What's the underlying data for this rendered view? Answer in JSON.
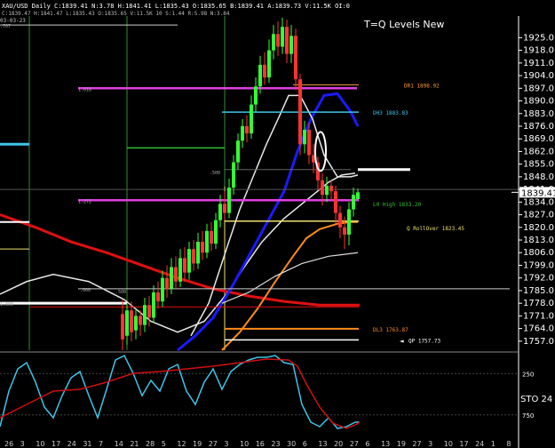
{
  "window": {
    "header": "XAU/USD  Daily  C:1839.41  N:3.78  H:1841.41  L:1835.43  O:1835.65  B:1839.41  A:1839.73  V:11.5K  OI:0",
    "sub_header": "C:1839.47 H:1841.47 L:1835.43 O:1835.65 V:11.5K 10 S:1.44 R:5.98 N:3.84",
    "title": "T=Q Levels New",
    "left_label": "03-03-23"
  },
  "colors": {
    "background": "#000000",
    "price_up": "#33ff33",
    "price_down": "#ff3333",
    "ma_blue": "#1a1aff",
    "ma_orange": "#ff8c1a",
    "ma_white": "#e8e8e8",
    "ma_red": "#e01010",
    "magenta": "#e040e0",
    "cyan": "#3fc6e8",
    "yellow": "#f0e070",
    "green_line": "#30c030",
    "grid_vertical": "#2f8f2f",
    "axis_text": "#ffffff"
  },
  "chart_data": [
    {
      "type": "candlestick",
      "title": "T=Q Levels New",
      "symbol": "XAU/USD",
      "timeframe": "Daily",
      "ylim": [
        1752,
        1937
      ],
      "y_ticks": [
        1925.0,
        1918.0,
        1911.0,
        1904.0,
        1897.0,
        1890.0,
        1883.0,
        1876.0,
        1869.0,
        1862.0,
        1855.0,
        1848.0,
        1841.0,
        1834.0,
        1827.0,
        1820.0,
        1813.0,
        1806.0,
        1799.0,
        1792.0,
        1785.0,
        1778.0,
        1771.0,
        1764.0,
        1757.0
      ],
      "current_price_label": "1839.41",
      "current_price": 1839.41,
      "x_tick_labels": [
        "26",
        "3",
        "10",
        "17",
        "24",
        "31",
        "7",
        "14",
        "21",
        "28",
        "5",
        "12",
        "19",
        "27",
        "3",
        "10",
        "16",
        "23",
        "30",
        "6",
        "13",
        "20",
        "27",
        "6",
        "13",
        "19",
        "27",
        "3",
        "10",
        "17",
        "24",
        "1",
        "8"
      ],
      "levels": [
        {
          "label": "DR1 1898.92",
          "value": 1898.92,
          "color": "magenta-label"
        },
        {
          "label": "DH3 1883.83",
          "value": 1883.83,
          "color": "cyan"
        },
        {
          "label": "L0 High 1833.20",
          "value": 1833.2,
          "color": "green"
        },
        {
          "label": "Q RollOver 1823.45",
          "value": 1823.45,
          "color": "yellow"
        },
        {
          "label": "DL3 1763.87",
          "value": 1763.87,
          "color": "orange"
        },
        {
          "label": "QP 1757.73",
          "value": 1757.73,
          "color": "white"
        }
      ],
      "fib_labels": [
        {
          "label": "1.618",
          "value": 1897.0
        },
        {
          "label": ".500",
          "value": 1851.0
        },
        {
          "label": "1.272",
          "value": 1835.0
        },
        {
          "label": ".000",
          "value": 1786.0
        },
        {
          "label": ".500",
          "value": 1785.0
        },
        {
          "label": "1.000",
          "value": 1778.0
        },
        {
          "label": ".707",
          "value": 1932.0
        }
      ],
      "candles": [
        {
          "x": 138,
          "open": 1772,
          "close": 1758,
          "high": 1780,
          "low": 1752
        },
        {
          "x": 143,
          "open": 1760,
          "close": 1774,
          "high": 1778,
          "low": 1755
        },
        {
          "x": 148,
          "open": 1774,
          "close": 1762,
          "high": 1779,
          "low": 1757
        },
        {
          "x": 153,
          "open": 1763,
          "close": 1771,
          "high": 1775,
          "low": 1758
        },
        {
          "x": 158,
          "open": 1771,
          "close": 1766,
          "high": 1774,
          "low": 1760
        },
        {
          "x": 163,
          "open": 1766,
          "close": 1777,
          "high": 1781,
          "low": 1762
        },
        {
          "x": 168,
          "open": 1777,
          "close": 1770,
          "high": 1782,
          "low": 1765
        },
        {
          "x": 173,
          "open": 1770,
          "close": 1784,
          "high": 1788,
          "low": 1767
        },
        {
          "x": 178,
          "open": 1784,
          "close": 1779,
          "high": 1790,
          "low": 1775
        },
        {
          "x": 183,
          "open": 1779,
          "close": 1792,
          "high": 1796,
          "low": 1776
        },
        {
          "x": 188,
          "open": 1792,
          "close": 1786,
          "high": 1799,
          "low": 1781
        },
        {
          "x": 193,
          "open": 1786,
          "close": 1798,
          "high": 1803,
          "low": 1783
        },
        {
          "x": 198,
          "open": 1798,
          "close": 1790,
          "high": 1804,
          "low": 1786
        },
        {
          "x": 203,
          "open": 1790,
          "close": 1803,
          "high": 1808,
          "low": 1787
        },
        {
          "x": 208,
          "open": 1803,
          "close": 1795,
          "high": 1809,
          "low": 1790
        },
        {
          "x": 213,
          "open": 1795,
          "close": 1808,
          "high": 1812,
          "low": 1791
        },
        {
          "x": 218,
          "open": 1808,
          "close": 1800,
          "high": 1813,
          "low": 1796
        },
        {
          "x": 223,
          "open": 1800,
          "close": 1812,
          "high": 1817,
          "low": 1797
        },
        {
          "x": 228,
          "open": 1812,
          "close": 1806,
          "high": 1818,
          "low": 1802
        },
        {
          "x": 233,
          "open": 1806,
          "close": 1818,
          "high": 1822,
          "low": 1803
        },
        {
          "x": 238,
          "open": 1818,
          "close": 1811,
          "high": 1823,
          "low": 1807
        },
        {
          "x": 243,
          "open": 1811,
          "close": 1824,
          "high": 1828,
          "low": 1808
        },
        {
          "x": 248,
          "open": 1824,
          "close": 1833,
          "high": 1838,
          "low": 1820
        },
        {
          "x": 253,
          "open": 1833,
          "close": 1828,
          "high": 1840,
          "low": 1824
        },
        {
          "x": 258,
          "open": 1828,
          "close": 1842,
          "high": 1847,
          "low": 1825
        },
        {
          "x": 263,
          "open": 1842,
          "close": 1856,
          "high": 1860,
          "low": 1838
        },
        {
          "x": 268,
          "open": 1856,
          "close": 1868,
          "high": 1872,
          "low": 1852
        },
        {
          "x": 273,
          "open": 1868,
          "close": 1876,
          "high": 1880,
          "low": 1864
        },
        {
          "x": 278,
          "open": 1876,
          "close": 1872,
          "high": 1882,
          "low": 1867
        },
        {
          "x": 283,
          "open": 1872,
          "close": 1888,
          "high": 1893,
          "low": 1869
        },
        {
          "x": 288,
          "open": 1888,
          "close": 1898,
          "high": 1903,
          "low": 1884
        },
        {
          "x": 293,
          "open": 1898,
          "close": 1910,
          "high": 1915,
          "low": 1894
        },
        {
          "x": 298,
          "open": 1910,
          "close": 1903,
          "high": 1917,
          "low": 1899
        },
        {
          "x": 303,
          "open": 1903,
          "close": 1918,
          "high": 1924,
          "low": 1900
        },
        {
          "x": 308,
          "open": 1918,
          "close": 1927,
          "high": 1932,
          "low": 1913
        },
        {
          "x": 313,
          "open": 1927,
          "close": 1920,
          "high": 1934,
          "low": 1915
        },
        {
          "x": 318,
          "open": 1920,
          "close": 1931,
          "high": 1936,
          "low": 1916
        },
        {
          "x": 323,
          "open": 1931,
          "close": 1916,
          "high": 1935,
          "low": 1911
        },
        {
          "x": 328,
          "open": 1916,
          "close": 1926,
          "high": 1932,
          "low": 1911
        },
        {
          "x": 333,
          "open": 1926,
          "close": 1902,
          "high": 1930,
          "low": 1896
        },
        {
          "x": 338,
          "open": 1902,
          "close": 1866,
          "high": 1905,
          "low": 1860
        },
        {
          "x": 343,
          "open": 1866,
          "close": 1874,
          "high": 1879,
          "low": 1861
        },
        {
          "x": 348,
          "open": 1874,
          "close": 1860,
          "high": 1878,
          "low": 1855
        },
        {
          "x": 353,
          "open": 1860,
          "close": 1856,
          "high": 1866,
          "low": 1850
        },
        {
          "x": 358,
          "open": 1856,
          "close": 1846,
          "high": 1859,
          "low": 1841
        },
        {
          "x": 363,
          "open": 1846,
          "close": 1838,
          "high": 1850,
          "low": 1832
        },
        {
          "x": 368,
          "open": 1838,
          "close": 1843,
          "high": 1848,
          "low": 1834
        },
        {
          "x": 373,
          "open": 1843,
          "close": 1840,
          "high": 1846,
          "low": 1835
        },
        {
          "x": 378,
          "open": 1840,
          "close": 1828,
          "high": 1843,
          "low": 1822
        },
        {
          "x": 383,
          "open": 1828,
          "close": 1820,
          "high": 1832,
          "low": 1814
        },
        {
          "x": 388,
          "open": 1820,
          "close": 1816,
          "high": 1826,
          "low": 1808
        },
        {
          "x": 393,
          "open": 1816,
          "close": 1830,
          "high": 1834,
          "low": 1810
        },
        {
          "x": 398,
          "open": 1830,
          "close": 1838,
          "high": 1842,
          "low": 1826
        },
        {
          "x": 403,
          "open": 1835.65,
          "close": 1839.41,
          "high": 1841.41,
          "low": 1835.43
        }
      ]
    },
    {
      "type": "line",
      "title": "STO",
      "series_label": "STO",
      "value": "24",
      "ylim": [
        0,
        1000
      ],
      "y_ticks_labels": [
        "250",
        "750"
      ]
    }
  ]
}
